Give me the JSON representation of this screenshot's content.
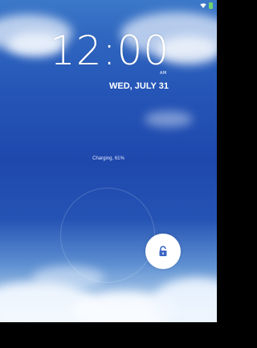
{
  "lockscreen": {
    "time": "12:00",
    "ampm": "AM",
    "date": "WED, JULY 31",
    "charging_status": "Charging, 61%"
  },
  "statusbar": {
    "icons": [
      "wifi-icon",
      "battery-charging-icon"
    ],
    "battery_color": "#6fd36f"
  },
  "unlock": {
    "icon": "unlock-icon",
    "accent": "#3a66c4"
  }
}
